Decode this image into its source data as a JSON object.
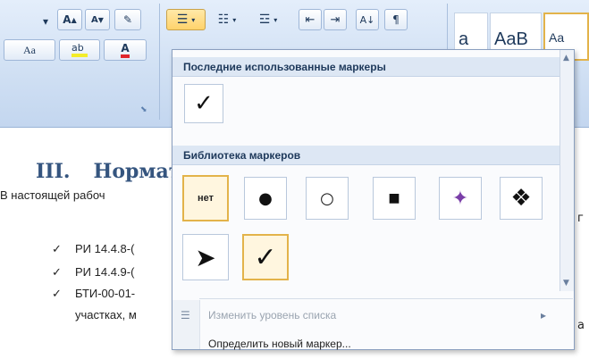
{
  "ribbon": {
    "font_size_dropdown_arrow": "▾",
    "grow_font_label": "A",
    "shrink_font_label": "A",
    "clear_format_label": "✎",
    "change_case_label": "Aa",
    "style_gallery": [
      "a",
      "AaB",
      "Aa"
    ],
    "dialog_launcher": "⬊"
  },
  "document": {
    "heading_number": "III.",
    "heading_text": "Нормат",
    "paragraph": "В настоящей рабоч",
    "bullets": [
      "РИ 14.4.8-(",
      "РИ 14.4.9-(",
      "БТИ-00-01-"
    ],
    "continuation": "участках, м",
    "right_fragment_1": "г",
    "right_fragment_2": "а"
  },
  "dropdown": {
    "recent_header": "Последние использованные маркеры",
    "library_header": "Библиотека маркеров",
    "recent_markers": [
      "✓"
    ],
    "library_markers": [
      {
        "label": "нет",
        "icon": "none",
        "selected": true
      },
      {
        "label": "●",
        "icon": "filled-circle",
        "selected": false
      },
      {
        "label": "○",
        "icon": "hollow-circle",
        "selected": false
      },
      {
        "label": "■",
        "icon": "filled-square",
        "selected": false
      },
      {
        "label": "✦",
        "icon": "colored-star",
        "selected": false
      },
      {
        "label": "❖",
        "icon": "four-diamonds",
        "selected": false
      },
      {
        "label": "➤",
        "icon": "arrowhead",
        "selected": false
      },
      {
        "label": "✓",
        "icon": "checkmark",
        "selected": true
      }
    ],
    "change_level_label": "Изменить уровень списка",
    "define_new_label": "Определить новый маркер...",
    "submenu_arrow": "▸"
  },
  "colors": {
    "highlight_yellow": "#f3ec2a",
    "font_red": "#e0262b",
    "selected_border": "#e3b34a",
    "disabled_text": "#9aa4b0"
  }
}
